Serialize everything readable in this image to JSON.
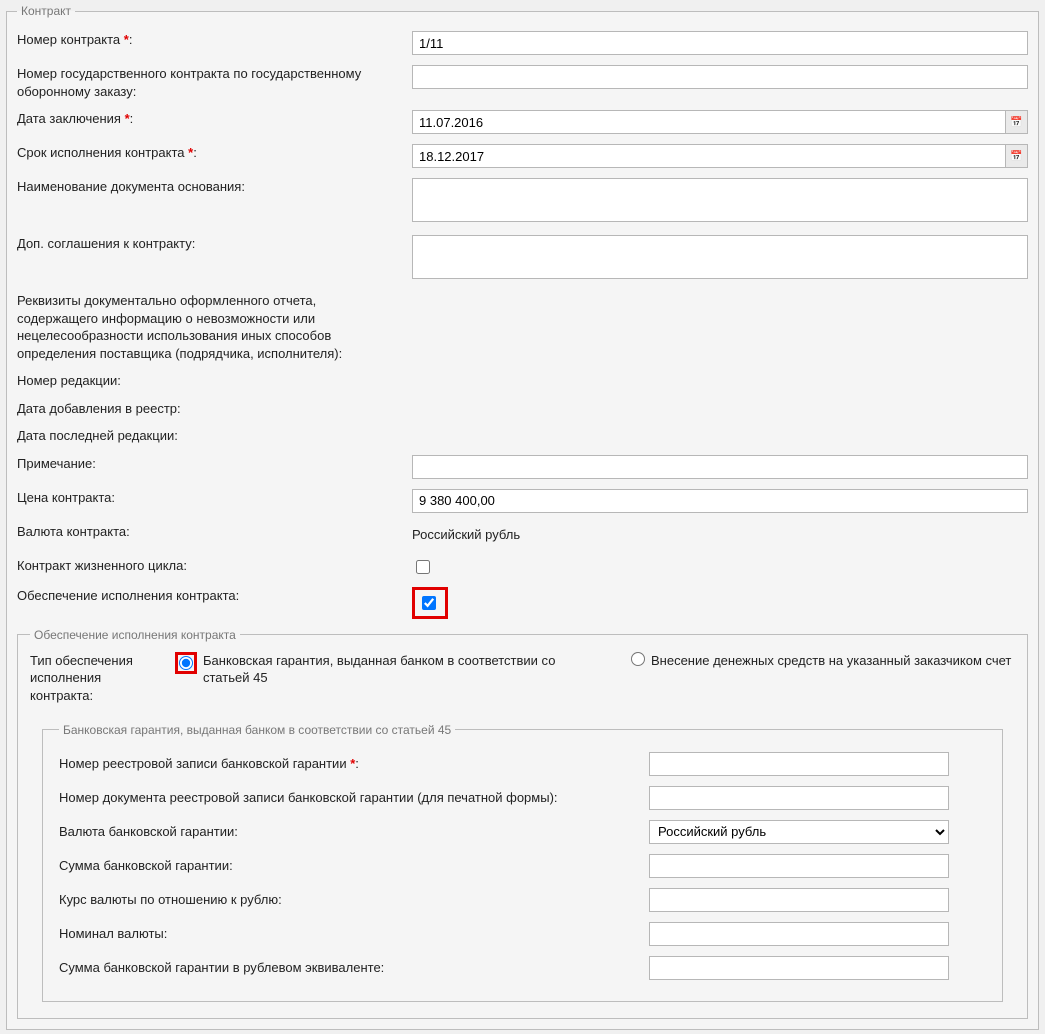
{
  "fieldset_title": "Контракт",
  "rows": {
    "contract_number": {
      "label": "Номер контракта",
      "required": true,
      "value": "1/11"
    },
    "gov_contract_number": {
      "label": "Номер государственного контракта по государственному оборонному заказу:",
      "value": ""
    },
    "conclusion_date": {
      "label": "Дата заключения",
      "required": true,
      "value": "11.07.2016"
    },
    "execution_deadline": {
      "label": "Срок исполнения контракта",
      "required": true,
      "value": "18.12.2017"
    },
    "basis_doc_name": {
      "label": "Наименование документа основания:",
      "value": ""
    },
    "addendums": {
      "label": "Доп. соглашения к контракту:",
      "value": ""
    },
    "requisites": {
      "label": "Реквизиты документально оформленного отчета, содержащего информацию о невозможности или нецелесообразности использования иных способов определения поставщика (подрядчика, исполнителя):",
      "value": ""
    },
    "edition_number": {
      "label": "Номер редакции:"
    },
    "registry_add_date": {
      "label": "Дата добавления в реестр:"
    },
    "last_edition_date": {
      "label": "Дата последней редакции:"
    },
    "note": {
      "label": "Примечание:",
      "value": ""
    },
    "contract_price": {
      "label": "Цена контракта:",
      "value": "9 380 400,00"
    },
    "contract_currency": {
      "label": "Валюта контракта:",
      "static_value": "Российский рубль"
    },
    "lifecycle_contract": {
      "label": "Контракт жизненного цикла:",
      "checked": false
    },
    "performance_security": {
      "label": "Обеспечение исполнения контракта:",
      "checked": true
    }
  },
  "security_fieldset": {
    "title": "Обеспечение исполнения контракта",
    "type_label": "Тип обеспечения исполнения контракта:",
    "option1": "Банковская гарантия, выданная банком в соответствии со статьей 45",
    "option2": "Внесение денежных средств на указанный заказчиком счет",
    "selected": "option1",
    "bank_fieldset": {
      "title": "Банковская гарантия, выданная банком в соответствии со статьей 45",
      "reg_number": {
        "label": "Номер реестровой записи банковской гарантии",
        "required": true,
        "value": ""
      },
      "doc_number": {
        "label": "Номер документа реестровой записи банковской гарантии (для печатной формы):",
        "value": ""
      },
      "currency": {
        "label": "Валюта банковской гарантии:",
        "value": "Российский рубль"
      },
      "amount": {
        "label": "Сумма банковской гарантии:",
        "value": ""
      },
      "rate": {
        "label": "Курс валюты по отношению к рублю:",
        "value": ""
      },
      "nominal": {
        "label": "Номинал валюты:",
        "value": ""
      },
      "amount_rub": {
        "label": "Сумма банковской гарантии в рублевом эквиваленте:",
        "value": ""
      }
    }
  }
}
